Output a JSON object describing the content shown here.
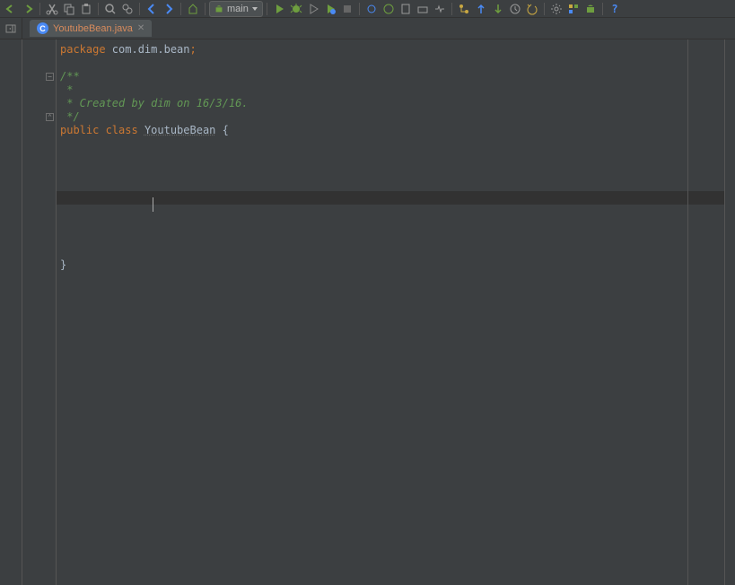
{
  "toolbar": {
    "run_config": "main"
  },
  "tabs": [
    {
      "icon": "C",
      "label": "YoutubeBean.java"
    }
  ],
  "code": {
    "package_kw": "package",
    "package_name": " com.dim.bean",
    "semicolon": ";",
    "doc_open": "/**",
    "doc_line1": " *",
    "doc_line2": " * Created by dim on 16/3/16.",
    "doc_close": " */",
    "public_kw": "public",
    "class_kw": " class ",
    "class_name": "YoutubeBean",
    "open_brace": " {",
    "close_brace": "}"
  }
}
